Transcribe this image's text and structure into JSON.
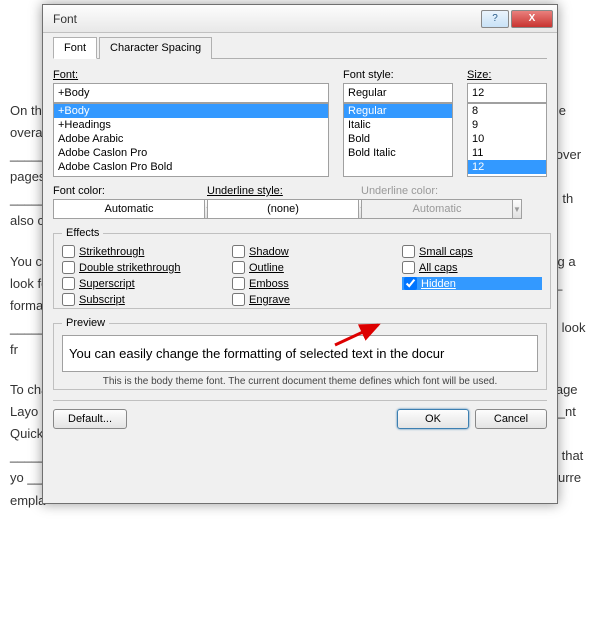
{
  "bg": {
    "p1": "On the ____________________________________________________________________ the overall look of ___________________________________________________________________ers, lists, cover pages, ____________________________________________________________________diagrams, th also co",
    "p2": "You ca___________________________________________________________________osing a look for the ___________________________________________________________________ format text directly ___________________________________________________________________ of using th look fr",
    "p3": "To cha ___________________________________________________________________e Page Layo ab. To ___________________________________________________________________nt Quick Sty Set co ___________________________________________________________________commands that yo ___________________________________________________________________n your curre empla"
  },
  "title": "Font",
  "tabs": {
    "font": "Font",
    "spacing": "Character Spacing"
  },
  "font": {
    "label": "Font:",
    "value": "+Body",
    "items": [
      "+Body",
      "+Headings",
      "Adobe Arabic",
      "Adobe Caslon Pro",
      "Adobe Caslon Pro Bold"
    ],
    "selected": 0
  },
  "style": {
    "label": "Font style:",
    "value": "Regular",
    "items": [
      "Regular",
      "Italic",
      "Bold",
      "Bold Italic"
    ],
    "selected": 0
  },
  "size": {
    "label": "Size:",
    "value": "12",
    "items": [
      "8",
      "9",
      "10",
      "11",
      "12"
    ],
    "selected": 4
  },
  "fontcolor": {
    "label": "Font color:",
    "value": "Automatic"
  },
  "ulstyle": {
    "label": "Underline style:",
    "value": "(none)"
  },
  "ulcolor": {
    "label": "Underline color:",
    "value": "Automatic"
  },
  "effects": {
    "legend": "Effects",
    "col1": [
      "Strikethrough",
      "Double strikethrough",
      "Superscript",
      "Subscript"
    ],
    "col2": [
      "Shadow",
      "Outline",
      "Emboss",
      "Engrave"
    ],
    "col3": [
      "Small caps",
      "All caps",
      "Hidden"
    ]
  },
  "preview": {
    "legend": "Preview",
    "text": "You can easily change the formatting of selected text in the docur",
    "note": "This is the body theme font. The current document theme defines which font will be used."
  },
  "buttons": {
    "default": "Default...",
    "ok": "OK",
    "cancel": "Cancel"
  }
}
